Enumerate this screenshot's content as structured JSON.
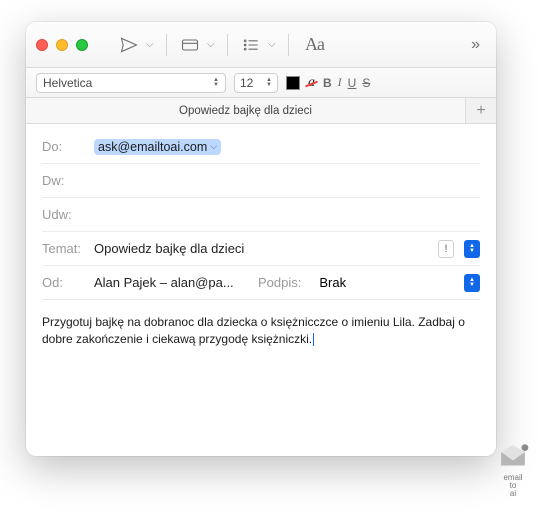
{
  "tab": {
    "title": "Opowiedz bajkę dla dzieci"
  },
  "format": {
    "font": "Helvetica",
    "size": "12"
  },
  "fields": {
    "to": {
      "label": "Do:",
      "token": "ask@emailtoai.com"
    },
    "cc": {
      "label": "Dw:"
    },
    "bcc": {
      "label": "Udw:"
    },
    "subject": {
      "label": "Temat:",
      "value": "Opowiedz bajkę dla dzieci"
    },
    "from": {
      "label": "Od:",
      "value": "Alan Pajek – alan@pa..."
    },
    "signature": {
      "label": "Podpis:",
      "value": "Brak"
    }
  },
  "body": "Przygotuj bajkę na dobranoc dla dziecka o księżnicczce o imieniu Lila. Zadbaj o dobre zakończenie i ciekawą przygodę księżniczki.",
  "brand": {
    "line1": "email",
    "line2": "to",
    "line3": "ai"
  }
}
